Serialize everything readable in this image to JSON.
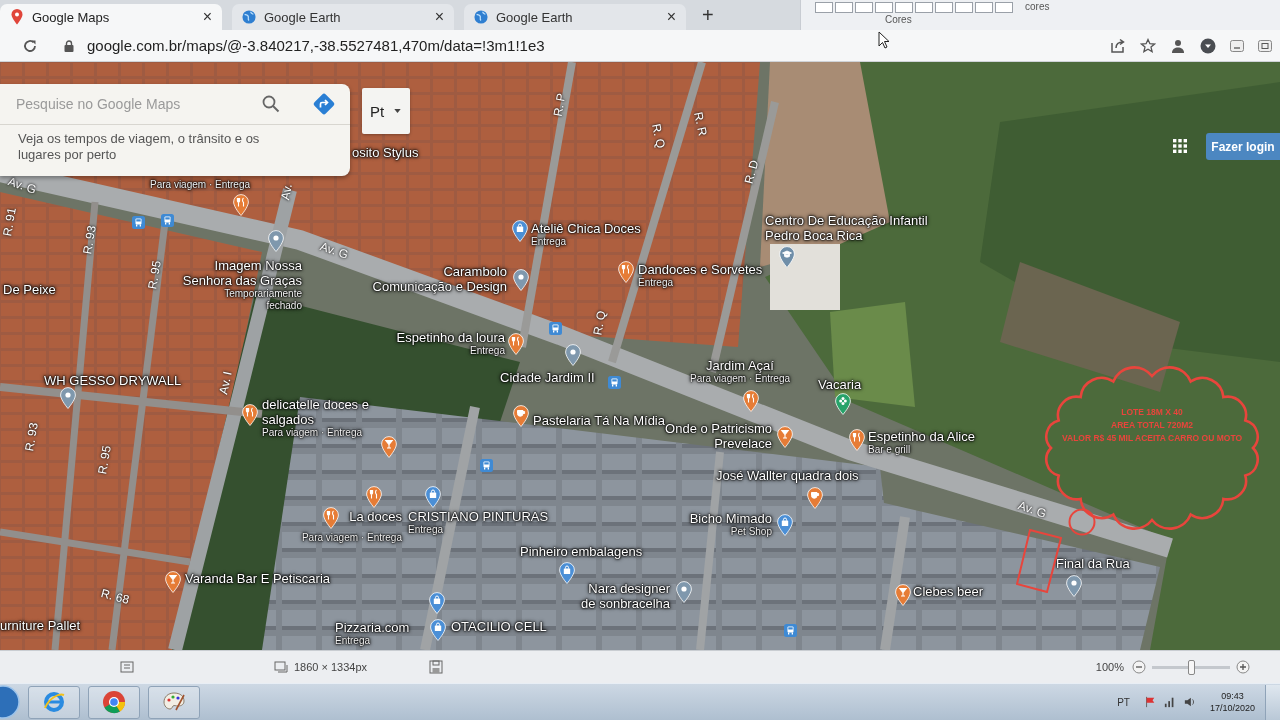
{
  "browser": {
    "tabs": [
      {
        "title": "Google Maps",
        "close": "×",
        "selected": true
      },
      {
        "title": "Google Earth",
        "close": "×",
        "selected": false
      },
      {
        "title": "Google Earth",
        "close": "×",
        "selected": false
      }
    ],
    "new_tab": "+",
    "address": "google.com.br/maps/@-3.840217,-38.5527481,470m/data=!3m1!1e3"
  },
  "paint_ribbon": {
    "labels": [
      "cores",
      "Cores"
    ]
  },
  "maps": {
    "search": {
      "placeholder": "Pesquise no Google Maps"
    },
    "hint": "Veja os tempos de viagem, o trânsito e os lugares por perto",
    "layer_button": "Pt",
    "login_button": "Fazer login",
    "streets": [
      "Av. G",
      "R. 91",
      "R. 93",
      "R. 95",
      "Av.",
      "Av. G",
      "Av. I",
      "R. 93",
      "R. 95",
      "R. 68",
      "R. P",
      "R. Q",
      "R. R",
      "R. D",
      "R. Q",
      "Av. G"
    ],
    "places": [
      {
        "name": "osito Stylus",
        "kind": "label"
      },
      {
        "subtitle": "Para viagem · Entrega",
        "kind": "restaurant"
      },
      {
        "kind": "transit"
      },
      {
        "kind": "transit"
      },
      {
        "name": "Ateliê Chica Doces",
        "subtitle": "Entrega",
        "kind": "shop"
      },
      {
        "name": "Imagem Nossa Senhora das Graças",
        "subtitle": "Temporariamente fechado",
        "kind": "place"
      },
      {
        "name": "Carambolo Comunicação e Design",
        "kind": "place"
      },
      {
        "name": "Dandoces e Sorvetes",
        "subtitle": "Entrega",
        "kind": "restaurant"
      },
      {
        "name": "Centro De Educação Infantil Pedro Boca Rica",
        "kind": "school"
      },
      {
        "name": "De Peixe",
        "kind": "label"
      },
      {
        "name": "Espetinho da loura",
        "subtitle": "Entrega",
        "kind": "restaurant"
      },
      {
        "kind": "transit"
      },
      {
        "name": "Cidade Jardim II",
        "kind": "place"
      },
      {
        "kind": "transit"
      },
      {
        "name": "Jardim Açaí",
        "subtitle": "Para viagem · Entrega",
        "kind": "restaurant"
      },
      {
        "name": "Vacaria",
        "kind": "garden"
      },
      {
        "name": "WH GESSO DRYWALL",
        "kind": "place"
      },
      {
        "name": "delicatelle doces e salgados",
        "subtitle": "Para viagem · Entrega",
        "kind": "restaurant"
      },
      {
        "name": "Pastelaria Tá Na Mídia",
        "kind": "cafe"
      },
      {
        "name": "Onde o Patricismo Prevelace",
        "kind": "bar"
      },
      {
        "name": "Espetinho da Alice",
        "subtitle": "Bar e grill",
        "kind": "restaurant"
      },
      {
        "kind": "bar"
      },
      {
        "kind": "transit"
      },
      {
        "name": "José Wallter quadra dois",
        "kind": "cafe"
      },
      {
        "kind": "restaurant"
      },
      {
        "kind": "shop"
      },
      {
        "name": "La doces",
        "subtitle": "Para viagem · Entrega",
        "kind": "restaurant"
      },
      {
        "name": "CRISTIANO PINTURAS",
        "subtitle": "Entrega",
        "kind": "label"
      },
      {
        "name": "Bicho Mimado",
        "subtitle": "Pet Shop",
        "kind": "shop"
      },
      {
        "name": "Pinheiro embalagens",
        "kind": "shop"
      },
      {
        "name": "Varanda Bar E Petiscaria",
        "kind": "bar"
      },
      {
        "name": "Final da Rua",
        "kind": "place"
      },
      {
        "name": "Nara designer de sonbracelha",
        "kind": "place"
      },
      {
        "name": "Clebes beer",
        "kind": "bar"
      },
      {
        "kind": "shop"
      },
      {
        "name": "urniture Pallet",
        "kind": "label"
      },
      {
        "name": "Pizzaria.com",
        "subtitle": "Entrega",
        "kind": "label"
      },
      {
        "name": "OTACILIO CELL",
        "kind": "shop"
      },
      {
        "kind": "transit"
      }
    ],
    "annotation": {
      "lines": [
        "LOTE 18M X 40",
        "AREA TOTAL 720M2",
        "VALOR R$ 45 MIL ACEITA CARRO OU MOTO"
      ]
    }
  },
  "image_viewer": {
    "dimensions": "1860 × 1334px",
    "zoom": "100%",
    "zoom_slider": {
      "level": 0.5
    }
  },
  "taskbar": {
    "language": "PT",
    "time": "09:43",
    "date": "17/10/2020"
  }
}
